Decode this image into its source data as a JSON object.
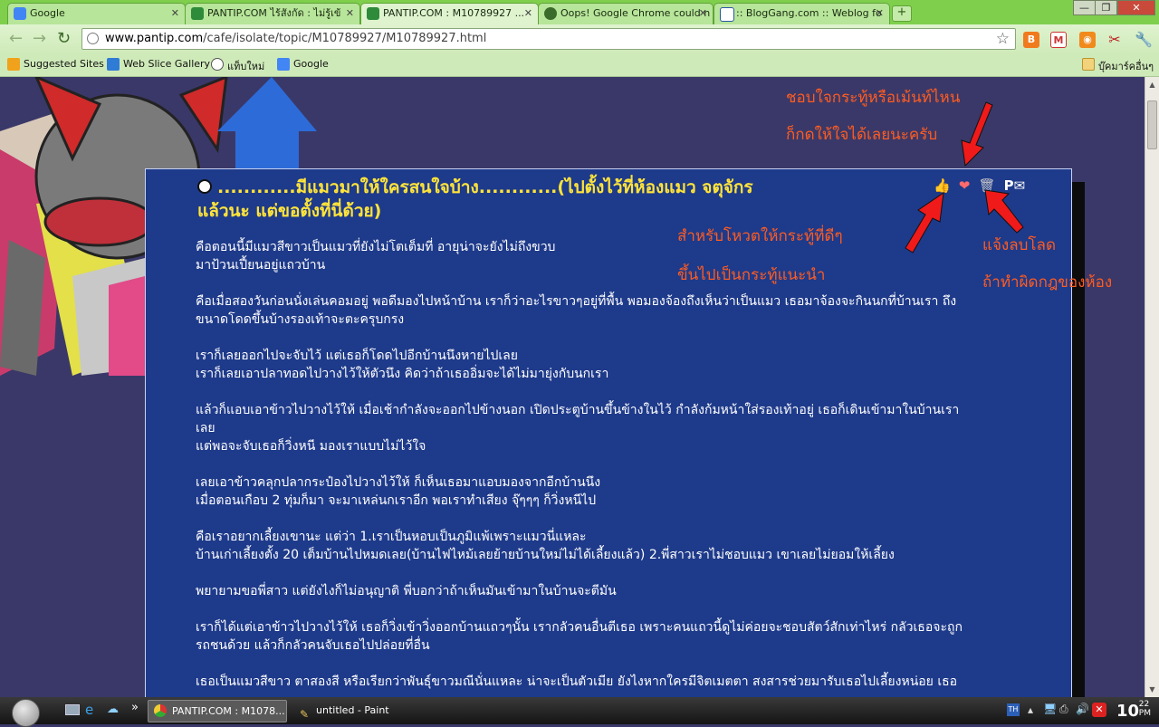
{
  "browser": {
    "tabs": [
      {
        "title": "Google",
        "icon": "google-icon"
      },
      {
        "title": "PANTIP.COM ไร้สังกัด : ไม่รู้เข้",
        "icon": "pantip-icon"
      },
      {
        "title": "PANTIP.COM : M10789927 ...",
        "icon": "pantip-icon",
        "active": true
      },
      {
        "title": "Oops! Google Chrome could n",
        "icon": "chrome-icon"
      },
      {
        "title": ":: BlogGang.com :: Weblog fo",
        "icon": "bloggang-icon"
      }
    ],
    "new_tab": "+",
    "window_controls": {
      "minimize": "—",
      "maximize": "❐",
      "close": "✕"
    },
    "url_host": "www.pantip.com",
    "url_path": "/cafe/isolate/topic/M10789927/M10789927.html",
    "bookmarks": [
      {
        "label": "Suggested Sites",
        "icon": "suggested-sites-icon"
      },
      {
        "label": "Web Slice Gallery",
        "icon": "ie-icon"
      },
      {
        "label": "แท็บใหม่",
        "icon": "new-tab-icon"
      },
      {
        "label": "Google",
        "icon": "google-icon"
      }
    ],
    "other_bookmarks": "บุ๊คมาร์คอื่นๆ"
  },
  "post": {
    "title_line1": "............มีแมวมาให้ใครสนใจบ้าง............(ไปตั้งไว้ที่ห้องแมว จตุจักร",
    "title_line2": "แล้วนะ แต่ขอตั้งที่นี่ด้วย)",
    "paragraphs": [
      [
        "คือตอนนี้มีแมวสีขาวเป็นแมวที่ยังไม่โตเต็มที่ อายุน่าจะยังไม่ถึงขวบ",
        "มาป้วนเปี้ยนอยู่แถวบ้าน"
      ],
      [
        "คือเมื่อสองวันก่อนนั่งเล่นคอมอยู่ พอดีมองไปหน้าบ้าน เราก็ว่าอะไรขาวๆอยู่ที่พื้น พอมองจ้องถึงเห็นว่าเป็นแมว เธอมาจ้องจะกินนกที่บ้านเรา ถึง",
        "ขนาดโดดขึ้นบ้างรองเท้าจะตะครุบกรง"
      ],
      [
        "เราก็เลยออกไปจะจับไว้ แต่เธอก็โดดไปอีกบ้านนึงหายไปเลย",
        "เราก็เลยเอาปลาทอดไปวางไว้ให้ตัวนึง คิดว่าถ้าเธออิ่มจะได้ไม่มายุ่งกับนกเรา"
      ],
      [
        "แล้วก็แอบเอาข้าวไปวางไว้ให้ เมื่อเช้ากำลังจะออกไปข้างนอก เปิดประตูบ้านขึ้นข้างในไว้ กำลังก้มหน้าใส่รองเท้าอยู่ เธอก็เดินเข้ามาในบ้านเรา",
        "เลย",
        "แต่พอจะจับเธอก็วิ่งหนี มองเราแบบไม่ไว้ใจ"
      ],
      [
        "เลยเอาข้าวคลุกปลากระป๋องไปวางไว้ให้ ก็เห็นเธอมาแอบมองจากอีกบ้านนึง",
        "เมื่อตอนเกือบ 2 ทุ่มก็มา จะมาเหล่นกเราอีก พอเราทำเสียง จุ๊ๆๆๆ ก็วิ่งหนีไป"
      ],
      [
        "คือเราอยากเลี้ยงเขานะ แต่ว่า 1.เราเป็นหอบเป็นภูมิแพ้เพราะแมวนี่แหละ",
        "บ้านเก่าเลี้ยงตั้ง 20 เต็มบ้านไปหมดเลย(บ้านไฟไหม้เลยย้ายบ้านใหม่ไม่ได้เลี้ยงแล้ว)  2.พี่สาวเราไม่ชอบแมว เขาเลยไม่ยอมให้เลี้ยง"
      ],
      [
        "พยายามขอพี่สาว แต่ยังไงก็ไม่อนุญาติ พี่บอกว่าถ้าเห็นมันเข้ามาในบ้านจะตีมัน"
      ],
      [
        "เราก็ได้แต่เอาข้าวไปวางไว้ให้ เธอก็วิ่งเข้าวิ่งออกบ้านแถวๆนั้น เรากลัวคนอื่นตีเธอ เพราะคนแถวนี้ดูไม่ค่อยจะชอบสัตว์สักเท่าไหร่ กลัวเธอจะถูก",
        "รถชนด้วย แล้วก็กลัวคนจับเธอไปปล่อยที่อื่น"
      ],
      [
        "เธอเป็นแมวสีขาว ตาสองสี หรือเรียกว่าพันธุ์ขาวมณีนั่นแหละ น่าจะเป็นตัวเมีย ยังไงหากใครมีจิตเมตตา สงสารช่วยมารับเธอไปเลี้ยงหน่อย เธอ"
      ]
    ]
  },
  "annotations": {
    "top_line1": "ชอบใจกระทู้หรือเม้นท์ไหน",
    "top_line2": "ก็กดให้ใจได้เลยนะครับ",
    "vote_line1": "สำหรับโหวตให้กระทู้ที่ดีๆ",
    "vote_line2": "ขึ้นไปเป็นกระทู้แนะนำ",
    "report_line1": "แจ้งลบโลด",
    "report_line2": "ถ้าทำผิดกฎของห้อง"
  },
  "post_icons": [
    "thumbs-up-icon",
    "heart-icon",
    "trash-icon",
    "p-mail-icon"
  ],
  "taskbar": {
    "items": [
      {
        "label": "PANTIP.COM : M1078...",
        "icon": "chrome-icon"
      },
      {
        "label": "untitled - Paint",
        "icon": "paint-icon"
      }
    ],
    "overflow": "»",
    "lang": "TH",
    "clock": "10",
    "clock_suffix_top": "22",
    "clock_suffix_bottom": "PM"
  },
  "colors": {
    "accent_title": "#ffe43a",
    "annotation": "#ff5c21",
    "post_bg": "#1e3a8a",
    "chrome_green": "#7fcf4d"
  }
}
